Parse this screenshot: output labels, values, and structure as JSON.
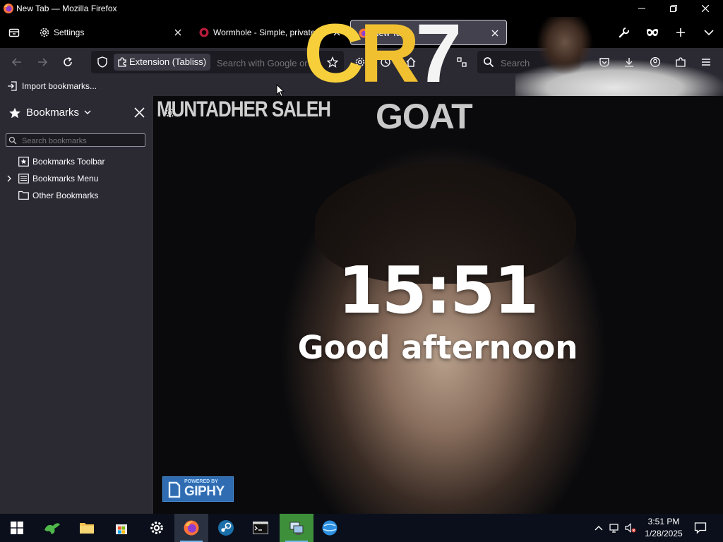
{
  "window": {
    "title": "New Tab — Mozilla Firefox",
    "controls": [
      "minimize-icon",
      "restore-icon",
      "close-icon"
    ]
  },
  "tabs": [
    {
      "label": "Settings",
      "icon": "gear-icon",
      "active": false
    },
    {
      "label": "Wormhole - Simple, private file",
      "icon": "wormhole-icon",
      "active": false
    },
    {
      "label": "New Tab",
      "icon": "firefox-icon",
      "active": true
    }
  ],
  "navbar": {
    "identity_label": "Extension (Tabliss)",
    "url_placeholder": "Search with Google or e",
    "search_placeholder": "Search"
  },
  "bookmarks_toolbar": {
    "import_label": "Import bookmarks..."
  },
  "theme_overlay": {
    "logo_text": "CR7"
  },
  "sidebar": {
    "title": "Bookmarks",
    "search_placeholder": "Search bookmarks",
    "items": [
      {
        "label": "Bookmarks Toolbar",
        "icon": "bookmarks-toolbar-icon",
        "expandable": false
      },
      {
        "label": "Bookmarks Menu",
        "icon": "bookmarks-menu-icon",
        "expandable": true
      },
      {
        "label": "Other Bookmarks",
        "icon": "folder-icon",
        "expandable": false
      }
    ]
  },
  "newtab": {
    "credit_text": "MUNTADHER SALEH",
    "background_caption": "GOAT",
    "clock": "15:51",
    "greeting": "Good afternoon",
    "giphy_powered": "POWERED BY",
    "giphy_brand": "GIPHY"
  },
  "taskbar": {
    "apps": [
      "start-icon",
      "gecko-app-icon",
      "file-explorer-icon",
      "microsoft-store-icon",
      "settings-icon",
      "firefox-icon",
      "steam-icon",
      "terminal-icon",
      "remote-desktop-icon",
      "globe-app-icon"
    ],
    "time": "3:51 PM",
    "date": "1/28/2025"
  },
  "colors": {
    "titlebar": "#000000",
    "toolbar": "#2b2a33",
    "sidebar": "#2b2a33",
    "taskbar": "#0a0f1b",
    "accent": "#f6cf3a",
    "giphy": "#2f6cb2"
  }
}
